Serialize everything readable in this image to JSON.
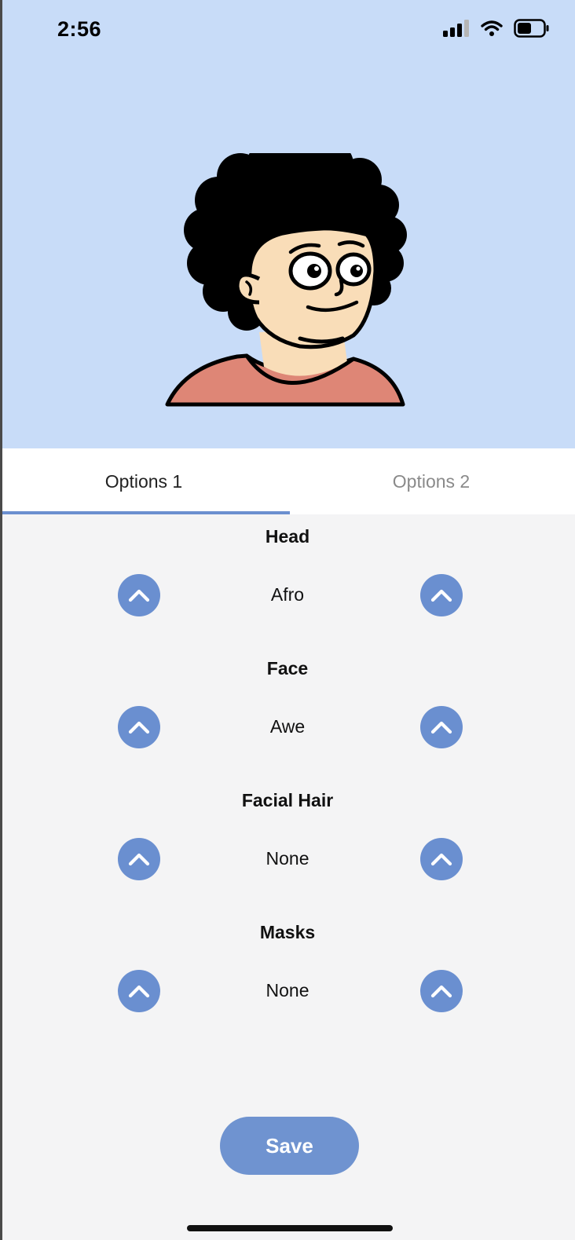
{
  "status_bar": {
    "time": "2:56"
  },
  "avatar": {
    "colors": {
      "background": "#c8dcf8",
      "hair": "#000000",
      "skin": "#f9ddb8",
      "shirt": "#de8676"
    }
  },
  "tabs": [
    {
      "label": "Options 1",
      "active": true
    },
    {
      "label": "Options 2",
      "active": false
    }
  ],
  "options": [
    {
      "title": "Head",
      "value": "Afro"
    },
    {
      "title": "Face",
      "value": "Awe"
    },
    {
      "title": "Facial Hair",
      "value": "None"
    },
    {
      "title": "Masks",
      "value": "None"
    }
  ],
  "save_label": "Save",
  "colors": {
    "accent": "#6b8fcf",
    "hero_background": "#c8dcf8",
    "page_background": "#f4f4f5"
  }
}
